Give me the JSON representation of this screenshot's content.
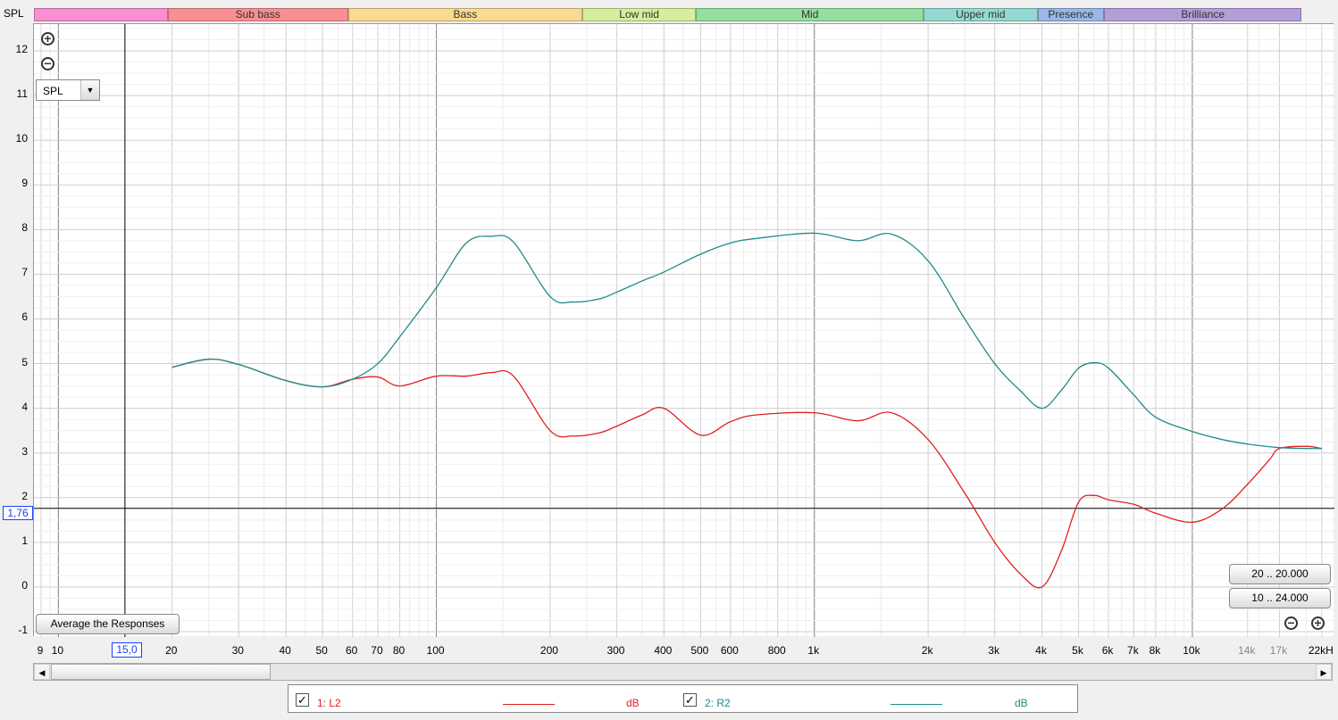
{
  "header": {
    "spl_label": "SPL"
  },
  "bands": [
    {
      "label": "",
      "color": "#f78fd0"
    },
    {
      "label": "Sub bass",
      "color": "#f88f93"
    },
    {
      "label": "Bass",
      "color": "#f9da90"
    },
    {
      "label": "Low mid",
      "color": "#d5ed9c"
    },
    {
      "label": "Mid",
      "color": "#94df9f"
    },
    {
      "label": "Upper mid",
      "color": "#94d9d1"
    },
    {
      "label": "Presence",
      "color": "#9ab7e6"
    },
    {
      "label": "Brilliance",
      "color": "#b59ed8"
    }
  ],
  "controls": {
    "zoom_in": "⊕",
    "zoom_out": "⊖",
    "spl_select": "SPL",
    "dropdown_arrow": "▼",
    "average_button": "Average the Responses",
    "range_button_1": "20 .. 20.000",
    "range_button_2": "10 .. 24.000",
    "scroll_left": "◀",
    "scroll_right": "▶"
  },
  "cursor": {
    "x_readout": "15,0",
    "y_readout": "1,76"
  },
  "y_ticks": [
    "12",
    "11",
    "10",
    "9",
    "8",
    "7",
    "6",
    "5",
    "4",
    "3",
    "2",
    "1",
    "0",
    "-1"
  ],
  "x_ticks": [
    "9",
    "10",
    "20",
    "30",
    "40",
    "50",
    "60",
    "70",
    "80",
    "100",
    "200",
    "300",
    "400",
    "500",
    "600",
    "800",
    "1k",
    "2k",
    "3k",
    "4k",
    "5k",
    "6k",
    "7k",
    "8k",
    "10k",
    "14k",
    "17k",
    "22kH"
  ],
  "x_tick_values": [
    9,
    10,
    20,
    30,
    40,
    50,
    60,
    70,
    80,
    100,
    200,
    300,
    400,
    500,
    600,
    800,
    1000,
    2000,
    3000,
    4000,
    5000,
    6000,
    7000,
    8000,
    10000,
    14000,
    17000,
    22000
  ],
  "legend": [
    {
      "checked": "✓",
      "name": "1: L2",
      "unit": "dB",
      "color": "#e02020"
    },
    {
      "checked": "✓",
      "name": "2: R2",
      "unit": "dB",
      "color": "#1f8a8a"
    }
  ],
  "chart_data": {
    "type": "line",
    "x_scale": "log",
    "xlim": [
      9,
      23000
    ],
    "ylim": [
      -1,
      12.6
    ],
    "grid": true,
    "series": [
      {
        "name": "1: L2",
        "color": "#e02020",
        "x": [
          20,
          25,
          30,
          40,
          50,
          60,
          70,
          80,
          100,
          120,
          140,
          160,
          200,
          230,
          270,
          300,
          350,
          400,
          500,
          600,
          700,
          1000,
          1300,
          1600,
          2000,
          2500,
          3000,
          3500,
          4000,
          4500,
          5000,
          5500,
          6000,
          7000,
          8000,
          10000,
          12000,
          14000,
          16000,
          17000,
          20000,
          22000
        ],
        "y": [
          4.92,
          5.1,
          4.98,
          4.62,
          4.48,
          4.65,
          4.7,
          4.5,
          4.72,
          4.72,
          4.8,
          4.72,
          3.5,
          3.38,
          3.45,
          3.6,
          3.85,
          4.0,
          3.4,
          3.7,
          3.85,
          3.9,
          3.72,
          3.9,
          3.3,
          2.1,
          1.0,
          0.3,
          0.0,
          0.8,
          1.9,
          2.05,
          1.95,
          1.85,
          1.65,
          1.45,
          1.75,
          2.3,
          2.85,
          3.1,
          3.15,
          3.1
        ]
      },
      {
        "name": "2: R2",
        "color": "#1f8a8a",
        "x": [
          20,
          25,
          30,
          40,
          50,
          60,
          70,
          80,
          100,
          120,
          140,
          160,
          200,
          230,
          270,
          300,
          350,
          400,
          500,
          600,
          700,
          1000,
          1300,
          1600,
          2000,
          2500,
          3000,
          3500,
          4000,
          4500,
          5000,
          5500,
          6000,
          7000,
          8000,
          10000,
          12000,
          14000,
          17000,
          20000,
          22000
        ],
        "y": [
          4.92,
          5.1,
          4.98,
          4.62,
          4.48,
          4.65,
          5.0,
          5.6,
          6.7,
          7.7,
          7.85,
          7.72,
          6.5,
          6.38,
          6.45,
          6.6,
          6.85,
          7.05,
          7.45,
          7.7,
          7.8,
          7.92,
          7.75,
          7.9,
          7.3,
          6.0,
          5.0,
          4.4,
          4.0,
          4.4,
          4.9,
          5.02,
          4.9,
          4.3,
          3.8,
          3.48,
          3.3,
          3.2,
          3.12,
          3.1,
          3.1
        ]
      }
    ]
  }
}
